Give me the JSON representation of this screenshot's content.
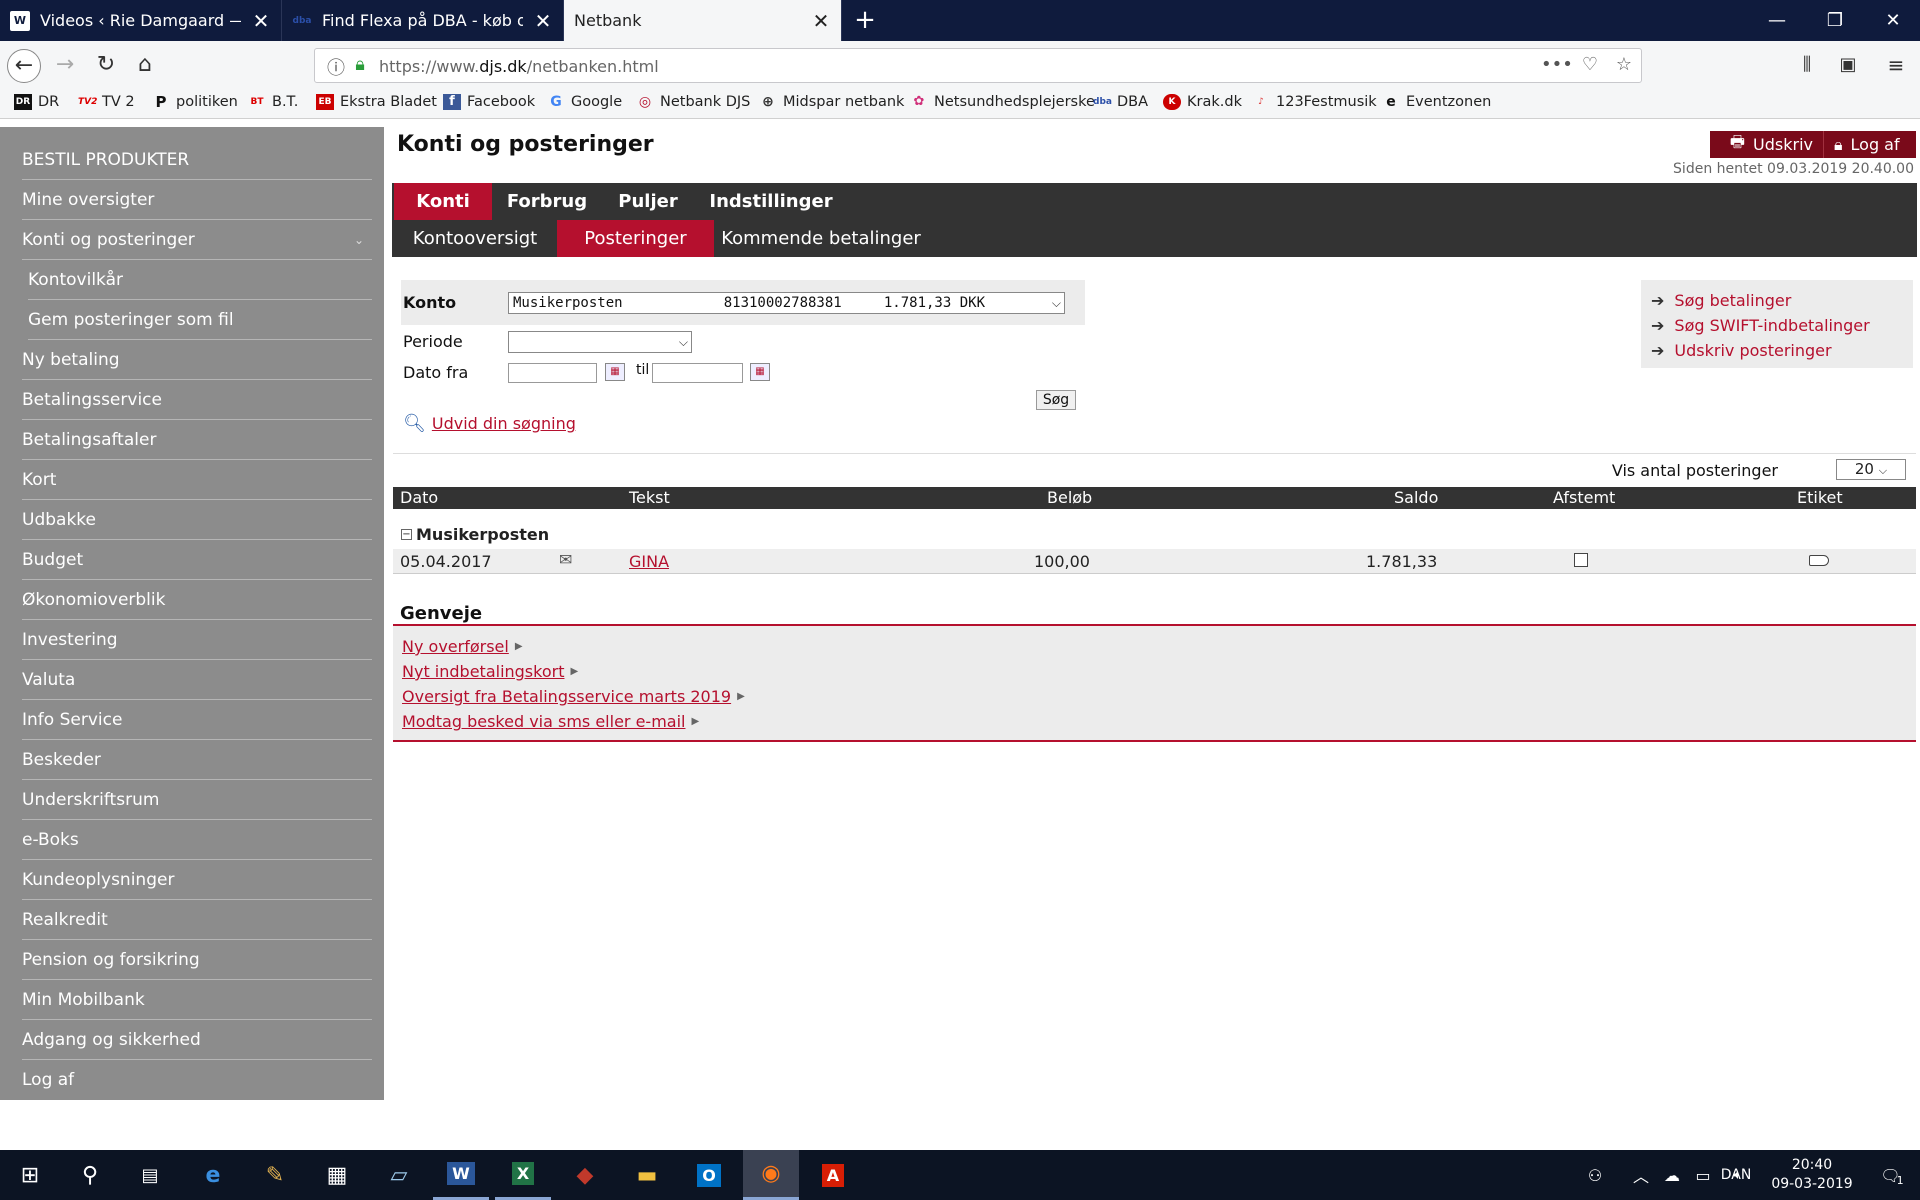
{
  "browser": {
    "tabs": [
      {
        "label": "Videos ‹ Rie Damgaard — Wor",
        "icon": "wordpress-icon",
        "active": false
      },
      {
        "label": "Find Flexa på DBA - køb og sal",
        "icon": "dba-icon",
        "active": false
      },
      {
        "label": "Netbank",
        "icon": "",
        "active": true
      }
    ],
    "url_prefix": "https://www.",
    "url_domain": "djs.dk",
    "url_path": "/netbanken.html",
    "bookmarks": [
      {
        "label": "DR",
        "icon": "DR"
      },
      {
        "label": "TV 2",
        "icon": "TV2"
      },
      {
        "label": "politiken",
        "icon": "P"
      },
      {
        "label": "B.T.",
        "icon": "BT"
      },
      {
        "label": "Ekstra Bladet",
        "icon": "EB"
      },
      {
        "label": "Facebook",
        "icon": "f"
      },
      {
        "label": "Google",
        "icon": "G"
      },
      {
        "label": "Netbank DJS",
        "icon": "◎"
      },
      {
        "label": "Midspar netbank",
        "icon": "⊕"
      },
      {
        "label": "Netsundhedsplejerske",
        "icon": "✿"
      },
      {
        "label": "DBA",
        "icon": "dba"
      },
      {
        "label": "Krak.dk",
        "icon": "K"
      },
      {
        "label": "123Festmusik",
        "icon": "♪"
      },
      {
        "label": "Eventzonen",
        "icon": "e"
      }
    ]
  },
  "sidebar": {
    "items": [
      {
        "label": "BESTIL PRODUKTER",
        "sub": false
      },
      {
        "label": "Mine oversigter",
        "sub": false
      },
      {
        "label": "Konti og posteringer",
        "sub": false,
        "expanded": true
      },
      {
        "label": "Kontovilkår",
        "sub": true
      },
      {
        "label": "Gem posteringer som fil",
        "sub": true
      },
      {
        "label": "Ny betaling",
        "sub": false
      },
      {
        "label": "Betalingsservice",
        "sub": false
      },
      {
        "label": "Betalingsaftaler",
        "sub": false
      },
      {
        "label": "Kort",
        "sub": false
      },
      {
        "label": "Udbakke",
        "sub": false
      },
      {
        "label": "Budget",
        "sub": false
      },
      {
        "label": "Økonomioverblik",
        "sub": false
      },
      {
        "label": "Investering",
        "sub": false
      },
      {
        "label": "Valuta",
        "sub": false
      },
      {
        "label": "Info Service",
        "sub": false
      },
      {
        "label": "Beskeder",
        "sub": false
      },
      {
        "label": "Underskriftsrum",
        "sub": false
      },
      {
        "label": "e-Boks",
        "sub": false
      },
      {
        "label": "Kundeoplysninger",
        "sub": false
      },
      {
        "label": "Realkredit",
        "sub": false
      },
      {
        "label": "Pension og forsikring",
        "sub": false
      },
      {
        "label": "Min Mobilbank",
        "sub": false
      },
      {
        "label": "Adgang og sikkerhed",
        "sub": false
      },
      {
        "label": "Log af",
        "sub": false
      }
    ]
  },
  "header": {
    "title": "Konti og posteringer",
    "print_label": "Udskriv",
    "logout_label": "Log af",
    "fetched": "Siden hentet 09.03.2019 20.40.00"
  },
  "main_tabs": [
    "Konti",
    "Forbrug",
    "Puljer",
    "Indstillinger"
  ],
  "sub_tabs": [
    "Kontooversigt",
    "Posteringer",
    "Kommende betalinger"
  ],
  "search": {
    "konto_label": "Konto",
    "konto_value": "Musikerposten            81310002788381     1.781,33 DKK",
    "periode_label": "Periode",
    "periode_value": "",
    "dato_fra_label": "Dato fra",
    "til_label": "til",
    "search_button": "Søg",
    "expand_link": "Udvid din søgning"
  },
  "side_links": [
    "Søg betalinger",
    "Søg SWIFT-indbetalinger",
    "Udskriv posteringer"
  ],
  "transactions": {
    "show_count_label": "Vis antal posteringer",
    "show_count_value": "20",
    "columns": [
      "Dato",
      "Tekst",
      "Beløb",
      "Saldo",
      "Afstemt",
      "Etiket"
    ],
    "group": "Musikerposten",
    "rows": [
      {
        "date": "05.04.2017",
        "text": "GINA",
        "amount": "100,00",
        "balance": "1.781,33",
        "reconciled": false
      }
    ]
  },
  "shortcuts": {
    "title": "Genveje",
    "links": [
      "Ny overførsel",
      "Nyt indbetalingskort",
      "Oversigt fra Betalingsservice marts 2019",
      "Modtag besked via sms eller e-mail"
    ]
  },
  "taskbar": {
    "language": "DAN",
    "time": "20:40",
    "date": "09-03-2019",
    "notification_count": "1"
  }
}
